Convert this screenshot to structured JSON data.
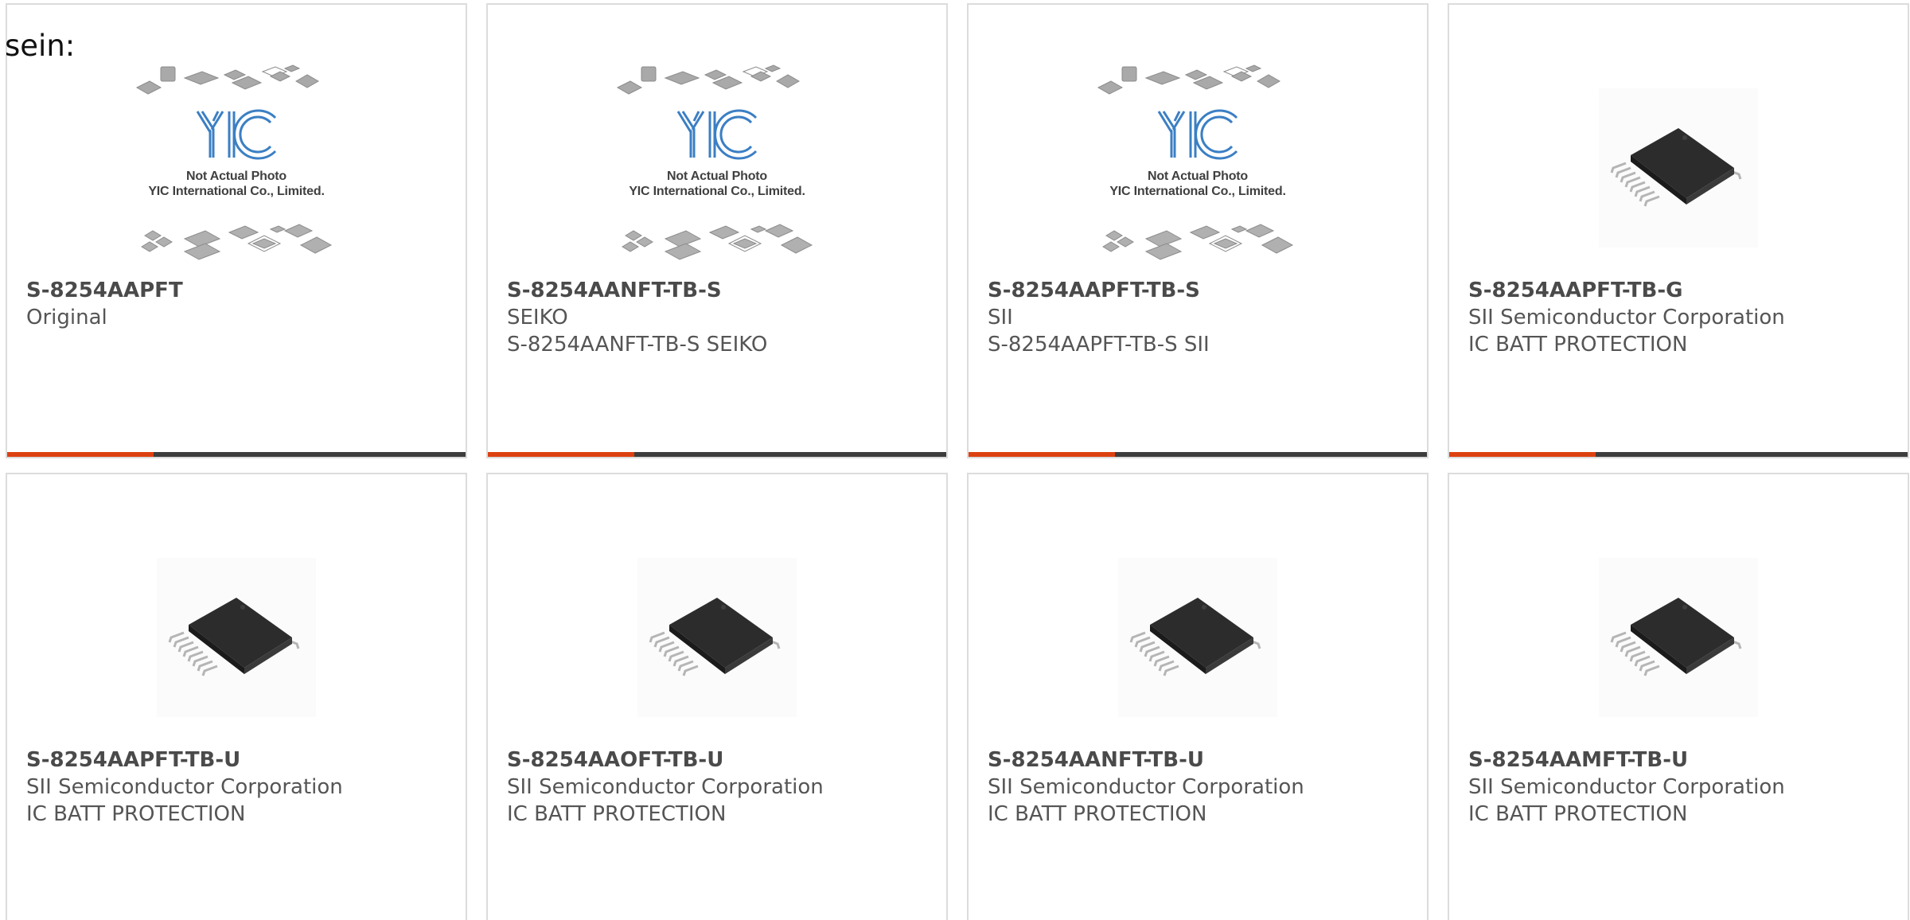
{
  "lead_text": "sein:",
  "placeholder": {
    "logo_text": "YIC",
    "line1": "Not Actual Photo",
    "line2": "YIC International Co., Limited."
  },
  "colors": {
    "accent": "#dd4111",
    "bar": "#3d3d3d",
    "border": "#dcdcdc",
    "text": "#555555"
  },
  "products": [
    {
      "part": "S-8254AAPFT",
      "line1": "Original",
      "line2": "",
      "image": "not-actual-photo-placeholder",
      "progress": 0.32
    },
    {
      "part": "S-8254AANFT-TB-S",
      "line1": "SEIKO",
      "line2": "S-8254AANFT-TB-S SEIKO",
      "image": "not-actual-photo-placeholder",
      "progress": 0.32
    },
    {
      "part": "S-8254AAPFT-TB-S",
      "line1": "SII",
      "line2": "S-8254AAPFT-TB-S SII",
      "image": "not-actual-photo-placeholder",
      "progress": 0.32
    },
    {
      "part": "S-8254AAPFT-TB-G",
      "line1": "SII Semiconductor Corporation",
      "line2": "IC BATT PROTECTION",
      "image": "tssop-chip-photo",
      "progress": 0.32
    },
    {
      "part": "S-8254AAPFT-TB-U",
      "line1": "SII Semiconductor Corporation",
      "line2": "IC BATT PROTECTION",
      "image": "tssop-chip-photo",
      "progress": 0.32
    },
    {
      "part": "S-8254AAOFT-TB-U",
      "line1": "SII Semiconductor Corporation",
      "line2": "IC BATT PROTECTION",
      "image": "tssop-chip-photo",
      "progress": 0.32
    },
    {
      "part": "S-8254AANFT-TB-U",
      "line1": "SII Semiconductor Corporation",
      "line2": "IC BATT PROTECTION",
      "image": "tssop-chip-photo",
      "progress": 0.32
    },
    {
      "part": "S-8254AAMFT-TB-U",
      "line1": "SII Semiconductor Corporation",
      "line2": "IC BATT PROTECTION",
      "image": "tssop-chip-photo",
      "progress": 0.32
    }
  ]
}
